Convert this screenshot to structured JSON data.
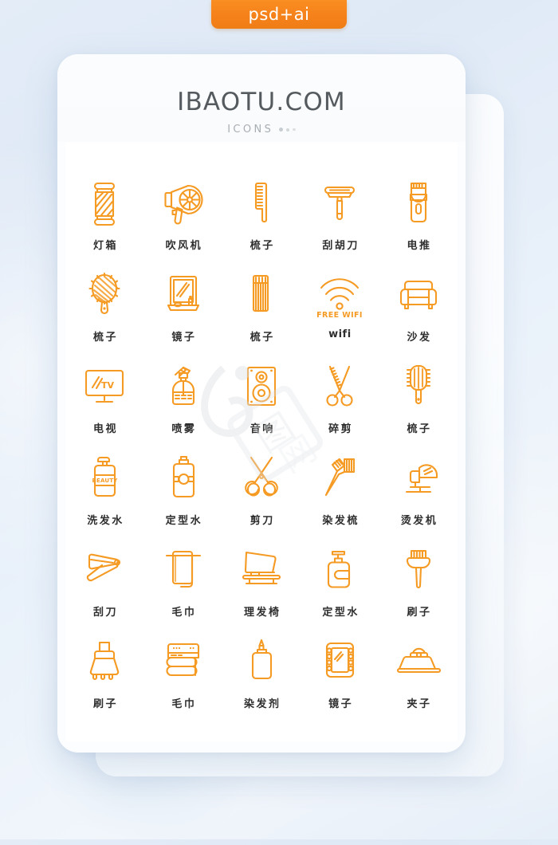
{
  "badge": {
    "label": "psd+ai"
  },
  "header": {
    "title": "IBAOTU.COM",
    "subtitle": "ICONS"
  },
  "theme": {
    "icon_stroke": "#F59A23",
    "badge_bg": "#F5811A",
    "card_bg": "#FFFFFF",
    "page_bg": "#E4EDF7",
    "label_color": "#2E2E2E",
    "title_color": "#555A5E"
  },
  "icons": [
    {
      "name": "barber-pole",
      "label": "灯箱",
      "latin": false,
      "inline_text": ""
    },
    {
      "name": "hair-dryer",
      "label": "吹风机",
      "latin": false,
      "inline_text": ""
    },
    {
      "name": "comb",
      "label": "梳子",
      "latin": false,
      "inline_text": ""
    },
    {
      "name": "razor",
      "label": "刮胡刀",
      "latin": false,
      "inline_text": ""
    },
    {
      "name": "hair-clipper",
      "label": "电推",
      "latin": false,
      "inline_text": ""
    },
    {
      "name": "paddle-brush",
      "label": "梳子",
      "latin": false,
      "inline_text": ""
    },
    {
      "name": "mirror-stand",
      "label": "镜子",
      "latin": false,
      "inline_text": ""
    },
    {
      "name": "fine-comb",
      "label": "梳子",
      "latin": false,
      "inline_text": ""
    },
    {
      "name": "wifi",
      "label": "wifi",
      "latin": true,
      "inline_text": "FREE WIFI"
    },
    {
      "name": "sofa",
      "label": "沙发",
      "latin": false,
      "inline_text": ""
    },
    {
      "name": "television",
      "label": "电视",
      "latin": false,
      "inline_text": "TV"
    },
    {
      "name": "spray-bottle",
      "label": "喷雾",
      "latin": false,
      "inline_text": ""
    },
    {
      "name": "speaker",
      "label": "音响",
      "latin": false,
      "inline_text": ""
    },
    {
      "name": "thinning-shears",
      "label": "碎剪",
      "latin": false,
      "inline_text": ""
    },
    {
      "name": "round-brush",
      "label": "梳子",
      "latin": false,
      "inline_text": ""
    },
    {
      "name": "shampoo-bottle",
      "label": "洗发水",
      "latin": false,
      "inline_text": "BEAUTY"
    },
    {
      "name": "styling-spray",
      "label": "定型水",
      "latin": false,
      "inline_text": ""
    },
    {
      "name": "scissors",
      "label": "剪刀",
      "latin": false,
      "inline_text": ""
    },
    {
      "name": "dye-comb",
      "label": "染发梳",
      "latin": false,
      "inline_text": ""
    },
    {
      "name": "perm-machine",
      "label": "烫发机",
      "latin": false,
      "inline_text": ""
    },
    {
      "name": "straight-razor",
      "label": "刮刀",
      "latin": false,
      "inline_text": ""
    },
    {
      "name": "hanging-towel",
      "label": "毛巾",
      "latin": false,
      "inline_text": ""
    },
    {
      "name": "barber-chair",
      "label": "理发椅",
      "latin": false,
      "inline_text": ""
    },
    {
      "name": "gel-pump-bottle",
      "label": "定型水",
      "latin": false,
      "inline_text": ""
    },
    {
      "name": "tint-brush",
      "label": "刷子",
      "latin": false,
      "inline_text": ""
    },
    {
      "name": "duster-brush",
      "label": "刷子",
      "latin": false,
      "inline_text": ""
    },
    {
      "name": "folded-towels",
      "label": "毛巾",
      "latin": false,
      "inline_text": ""
    },
    {
      "name": "dye-applicator",
      "label": "染发剂",
      "latin": false,
      "inline_text": ""
    },
    {
      "name": "vanity-mirror",
      "label": "镜子",
      "latin": false,
      "inline_text": ""
    },
    {
      "name": "hair-clip",
      "label": "夹子",
      "latin": false,
      "inline_text": ""
    }
  ]
}
